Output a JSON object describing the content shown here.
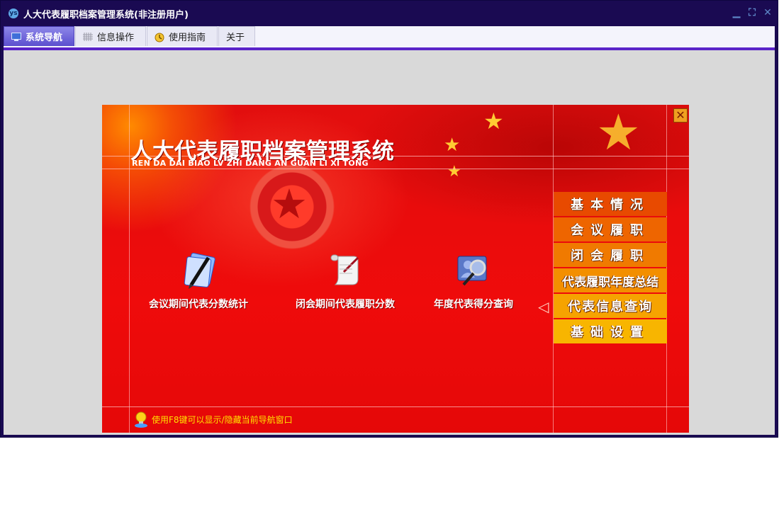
{
  "window": {
    "title": "人大代表履职档案管理系统(非注册用户)",
    "app_icon": "ys"
  },
  "window_controls": [
    {
      "name": "minimize",
      "glyph": "▁"
    },
    {
      "name": "restore",
      "glyph": "⛶"
    },
    {
      "name": "close",
      "glyph": "✕"
    }
  ],
  "menu": {
    "tabs": [
      {
        "label": "系统导航",
        "icon": "monitor-icon",
        "active": true
      },
      {
        "label": "信息操作",
        "icon": "grid-icon",
        "active": false
      },
      {
        "label": "使用指南",
        "icon": "clock-icon",
        "active": false
      },
      {
        "label": "关于",
        "icon": "",
        "active": false
      }
    ]
  },
  "banner": {
    "title": "人大代表履职档案管理系统",
    "subtitle": "REN DA DAI BIAO LV ZHI DANG AN GUAN LI XI TONG",
    "close_glyph": "✕",
    "functions": [
      {
        "label": "会议期间代表分数统计",
        "icon": "pen-document-icon"
      },
      {
        "label": "闭会期间代表履职分数",
        "icon": "scroll-icon"
      },
      {
        "label": "年度代表得分查询",
        "icon": "user-search-icon"
      }
    ],
    "side_menu": [
      "基本情况",
      "会议履职",
      "闭会履职",
      "代表履职年度总结",
      "代表信息查询",
      "基础设置"
    ],
    "hint": "使用F8键可以显示/隐藏当前导航窗口"
  },
  "colors": {
    "titlebar": "#1a0a52",
    "accent_underline": "#5a24c9",
    "banner_red": "#ee0b0b",
    "hint_text": "#ffe000"
  }
}
